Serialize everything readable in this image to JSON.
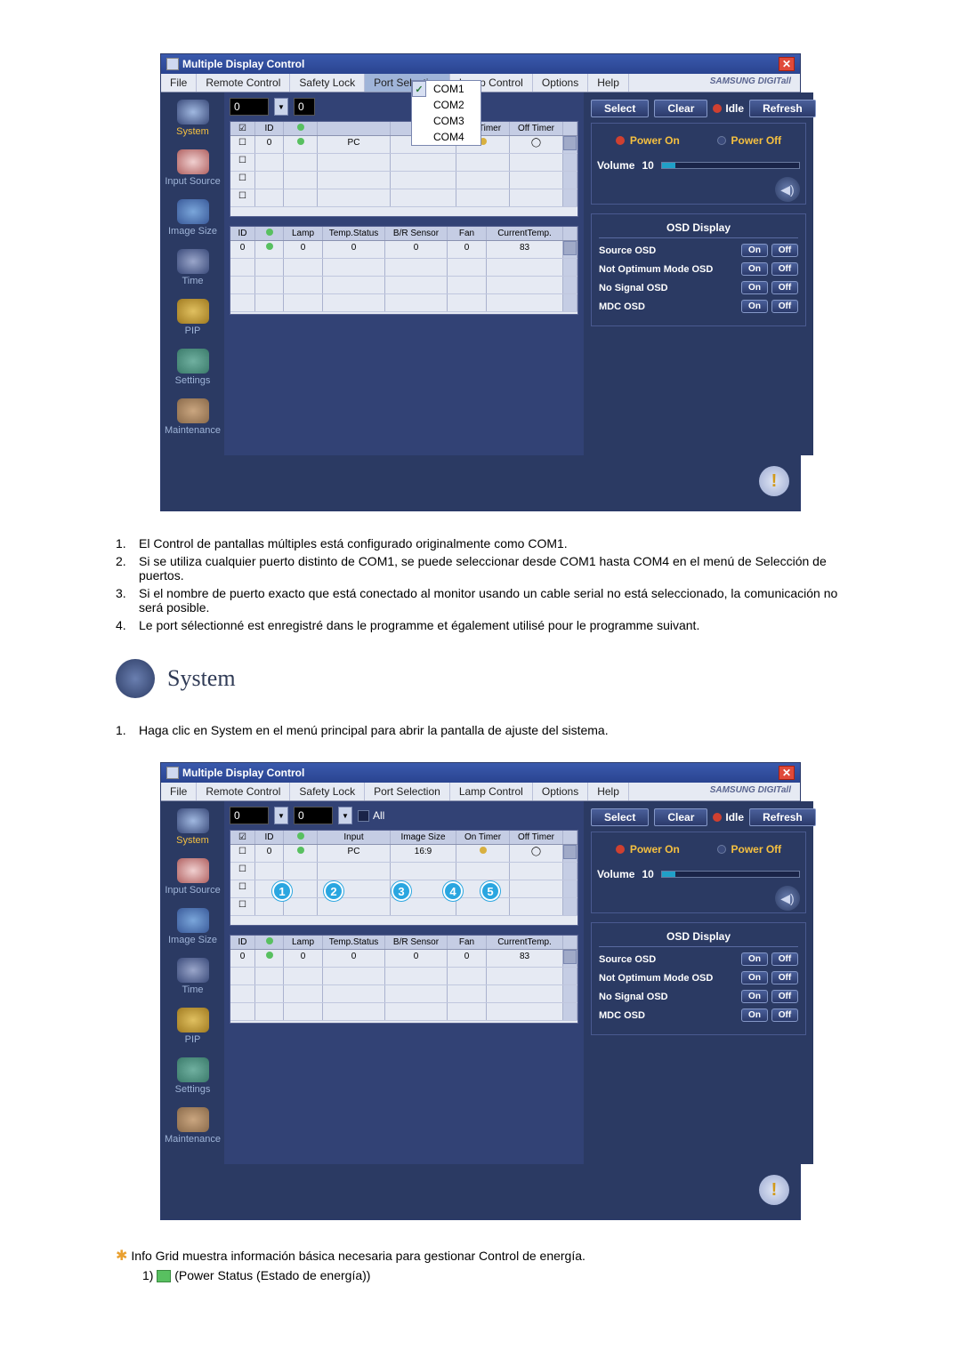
{
  "app": {
    "title": "Multiple Display Control",
    "brand": "SAMSUNG DIGITall",
    "menu": [
      "File",
      "Remote Control",
      "Safety Lock",
      "Port Selection",
      "Lamp Control",
      "Options",
      "Help"
    ],
    "port_menu": [
      "COM1",
      "COM2",
      "COM3",
      "COM4"
    ],
    "sidebar": [
      {
        "label": "System"
      },
      {
        "label": "Input Source"
      },
      {
        "label": "Image Size"
      },
      {
        "label": "Time"
      },
      {
        "label": "PIP"
      },
      {
        "label": "Settings"
      },
      {
        "label": "Maintenance"
      }
    ],
    "top": {
      "num1": "0",
      "num2": "0",
      "all": "All",
      "select_btn": "Select",
      "clear_btn": "Clear",
      "idle_label": "Idle",
      "refresh_btn": "Refresh"
    },
    "power": {
      "on": "Power On",
      "off": "Power Off",
      "volume_label": "Volume",
      "volume_value": "10"
    },
    "grid1": {
      "headers": [
        "",
        "ID",
        "",
        "Input",
        "Image Size",
        "On Timer",
        "Off Timer"
      ],
      "headers_alt": [
        "",
        "ID",
        "",
        "",
        "e Size",
        "On Timer",
        "Off Timer"
      ],
      "row": {
        "id": "0",
        "input": "PC",
        "size": "16:9"
      }
    },
    "grid2": {
      "headers": [
        "ID",
        "",
        "Lamp",
        "Temp.Status",
        "B/R Sensor",
        "Fan",
        "CurrentTemp."
      ],
      "row": {
        "id": "0",
        "lamp": "0",
        "temp": "0",
        "sensor": "0",
        "fan": "0",
        "curr": "83"
      }
    },
    "osd": {
      "title": "OSD Display",
      "items": [
        "Source OSD",
        "Not Optimum Mode OSD",
        "No Signal OSD",
        "MDC OSD"
      ],
      "on": "On",
      "off": "Off"
    }
  },
  "text_block_1": [
    "El Control de pantallas múltiples está configurado originalmente como COM1.",
    "Si se utiliza cualquier puerto distinto de COM1, se puede seleccionar desde COM1 hasta COM4 en el menú de Selección de puertos.",
    "Si el nombre de puerto exacto que está conectado al monitor usando un cable serial no está seleccionado, la comunicación no será posible.",
    "Le port sélectionné est enregistré dans le programme et également utilisé pour le programme suivant."
  ],
  "section": {
    "title": "System",
    "item1": "Haga clic en System en el menú principal para abrir la pantalla de ajuste del sistema."
  },
  "lower": {
    "info_line": "Info Grid muestra información básica necesaria para gestionar Control de energía.",
    "sub1_num": "1)",
    "sub1_text": "(Power Status (Estado de energía))"
  }
}
